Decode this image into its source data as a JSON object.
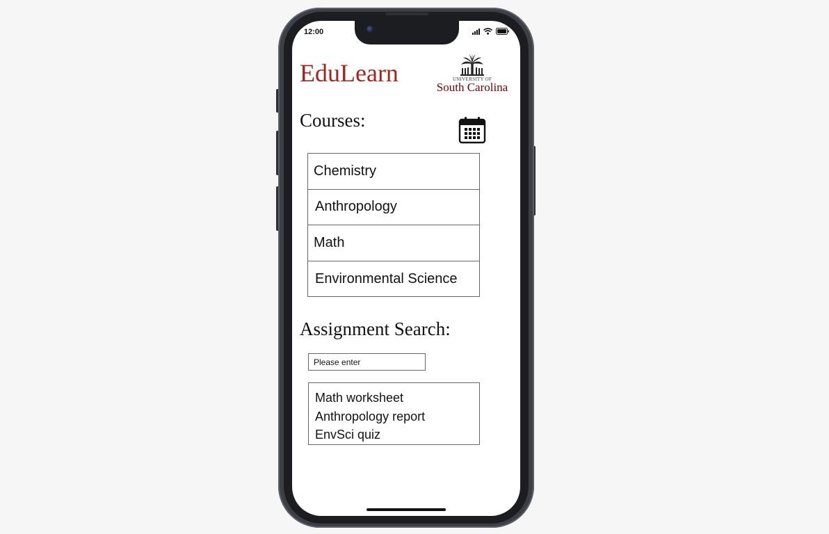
{
  "status_bar": {
    "time": "12:00",
    "icons": [
      "cellular-signal-icon",
      "wifi-icon",
      "battery-icon"
    ]
  },
  "header": {
    "app_title": "EduLearn",
    "logo": {
      "line1": "UNIVERSITY OF",
      "line2": "South Carolina",
      "icon": "palmetto-tree-icon"
    }
  },
  "courses": {
    "heading": "Courses:",
    "calendar_icon": "calendar-icon",
    "items": [
      {
        "label": "Chemistry"
      },
      {
        "label": "Anthropology"
      },
      {
        "label": "Math"
      },
      {
        "label": "Environmental Science"
      }
    ]
  },
  "assignment_search": {
    "heading": "Assignment Search:",
    "input_value": "",
    "input_placeholder": "Please enter",
    "results": [
      {
        "label": "Math worksheet"
      },
      {
        "label": "Anthropology report"
      },
      {
        "label": "EnvSci quiz"
      }
    ]
  },
  "colors": {
    "brand_title": "#a3261e",
    "garnet": "#73000a",
    "phone_frame": "#3c3f46",
    "background": "#f6f6f6"
  }
}
